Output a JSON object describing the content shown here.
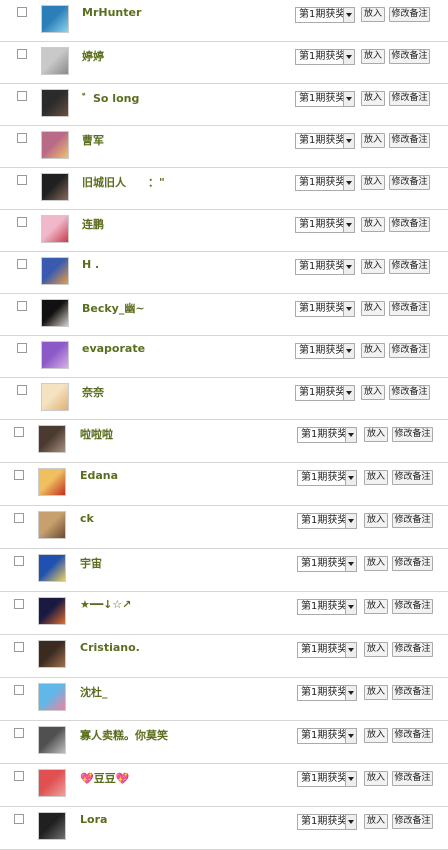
{
  "colors": {
    "name": "#5b6e1e",
    "divider": "#d6d6d6"
  },
  "rows": [
    {
      "name": "MrHunter",
      "award": "第1期获奖",
      "put_label": "放入",
      "note_label": "修改备注",
      "avatar_colors": [
        "#2a7fb8",
        "#8fd3f0"
      ]
    },
    {
      "name": "婷婷",
      "award": "第1期获奖",
      "put_label": "放入",
      "note_label": "修改备注",
      "avatar_colors": [
        "#c9c9c9",
        "#8a8a8a"
      ]
    },
    {
      "name": "゛So long",
      "award": "第1期获奖",
      "put_label": "放入",
      "note_label": "修改备注",
      "avatar_colors": [
        "#2b2b2b",
        "#6a5040"
      ]
    },
    {
      "name": "曹军",
      "award": "第1期获奖",
      "put_label": "放入",
      "note_label": "修改备注",
      "avatar_colors": [
        "#b86a86",
        "#f2c26a"
      ]
    },
    {
      "name": "旧城旧人　　：\"",
      "award": "第1期获奖",
      "put_label": "放入",
      "note_label": "修改备注",
      "avatar_colors": [
        "#202020",
        "#8a6a5a"
      ]
    },
    {
      "name": "连鹏",
      "award": "第1期获奖",
      "put_label": "放入",
      "note_label": "修改备注",
      "avatar_colors": [
        "#f0b8c8",
        "#c83c4c"
      ]
    },
    {
      "name": "H .",
      "award": "第1期获奖",
      "put_label": "放入",
      "note_label": "修改备注",
      "avatar_colors": [
        "#3a5ab0",
        "#e8a040"
      ]
    },
    {
      "name": "Becky_幽~",
      "award": "第1期获奖",
      "put_label": "放入",
      "note_label": "修改备注",
      "avatar_colors": [
        "#111111",
        "#d8d0c8"
      ]
    },
    {
      "name": "evaporate",
      "award": "第1期获奖",
      "put_label": "放入",
      "note_label": "修改备注",
      "avatar_colors": [
        "#8c5ac8",
        "#d8b0e8"
      ]
    },
    {
      "name": "奈奈",
      "award": "第1期获奖",
      "put_label": "放入",
      "note_label": "修改备注",
      "avatar_colors": [
        "#f4e2c0",
        "#e0b070"
      ]
    },
    {
      "name": "啦啦啦",
      "award": "第1期获奖",
      "put_label": "放入",
      "note_label": "修改备注",
      "avatar_colors": [
        "#4a3a30",
        "#a89080"
      ]
    },
    {
      "name": "Edana",
      "award": "第1期获奖",
      "put_label": "放入",
      "note_label": "修改备注",
      "avatar_colors": [
        "#f0c060",
        "#c03020"
      ]
    },
    {
      "name": "ck",
      "award": "第1期获奖",
      "put_label": "放入",
      "note_label": "修改备注",
      "avatar_colors": [
        "#c8a070",
        "#6a4a30"
      ]
    },
    {
      "name": "宇宙",
      "award": "第1期获奖",
      "put_label": "放入",
      "note_label": "修改备注",
      "avatar_colors": [
        "#2050b0",
        "#f0d060"
      ]
    },
    {
      "name": "★━━↓☆↗",
      "award": "第1期获奖",
      "put_label": "放入",
      "note_label": "修改备注",
      "avatar_colors": [
        "#1a1a40",
        "#e07030"
      ]
    },
    {
      "name": "Cristiano.",
      "award": "第1期获奖",
      "put_label": "放入",
      "note_label": "修改备注",
      "avatar_colors": [
        "#3a2a20",
        "#a07050"
      ]
    },
    {
      "name": "沈杜_",
      "award": "第1期获奖",
      "put_label": "放入",
      "note_label": "修改备注",
      "avatar_colors": [
        "#60b8e8",
        "#f080a0"
      ]
    },
    {
      "name": "寡人卖糕。你莫笑",
      "award": "第1期获奖",
      "put_label": "放入",
      "note_label": "修改备注",
      "avatar_colors": [
        "#505050",
        "#c0c0c0"
      ]
    },
    {
      "name": "💖豆豆💖",
      "award": "第1期获奖",
      "put_label": "放入",
      "note_label": "修改备注",
      "avatar_colors": [
        "#e05050",
        "#f0a0a0"
      ]
    },
    {
      "name": "Lora",
      "award": "第1期获奖",
      "put_label": "放入",
      "note_label": "修改备注",
      "avatar_colors": [
        "#202020",
        "#707070"
      ]
    }
  ]
}
